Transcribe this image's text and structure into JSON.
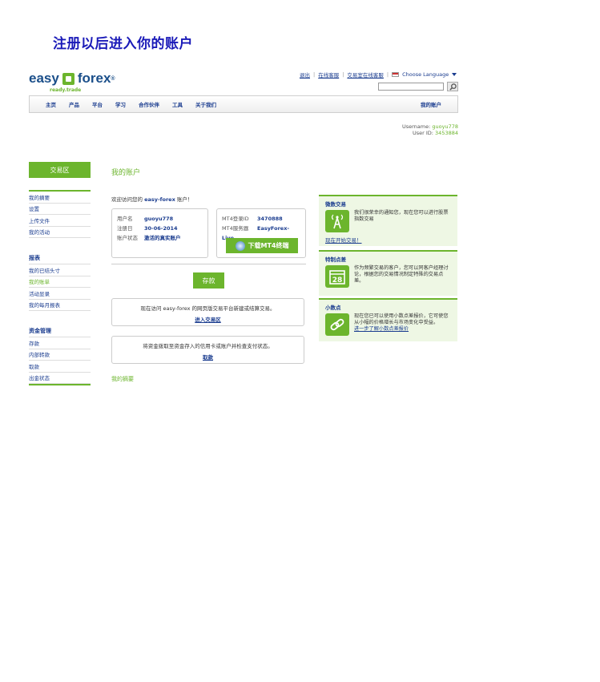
{
  "page_heading": "注册以后进入你的账户",
  "logo": {
    "word1": "easy",
    "word2": "forex",
    "reg": "®",
    "tagline": "ready.trade"
  },
  "top_links": {
    "logout": "退出",
    "support": "在线客服",
    "trading_room": "交易室在线客服",
    "language": "Choose Language"
  },
  "nav": {
    "items": [
      "主页",
      "产品",
      "平台",
      "学习",
      "合作伙伴",
      "工具",
      "关于我们"
    ],
    "my_account": "我的账户"
  },
  "user": {
    "username_label": "Username:",
    "username": "guoyu778",
    "userid_label": "User ID:",
    "userid": "3453884"
  },
  "sidebar": {
    "trade_button": "交易区",
    "group1": [
      "我的摘要",
      "设置",
      "上传文件",
      "我的活动"
    ],
    "group2_title": "报表",
    "group2": [
      "我的已结头寸",
      "我的账单",
      "活动显录",
      "我的每月报表"
    ],
    "group3_title": "资金管理",
    "group3": [
      "存款",
      "内部转款",
      "取款",
      "出金状态"
    ]
  },
  "main": {
    "title": "我的账户",
    "welcome_prefix": "欢迎访问您的 ",
    "welcome_brand": "easy-forex",
    "welcome_suffix": " 账户！",
    "account": {
      "username_label": "用户名",
      "username": "guoyu778",
      "reg_date_label": "注册日",
      "reg_date": "30-06-2014",
      "status_label": "账户状态",
      "status": "激活的真实账户"
    },
    "mt4": {
      "login_label": "MT4登录ID",
      "login": "3470888",
      "server_label": "MT4服务器",
      "server": "EasyForex-Live",
      "download_button": "下载MT4终端"
    },
    "deposit_button": "存款",
    "info1_text": "现在访问 easy-forex 的网页版交易平台新建或结算交易。",
    "info1_link": "进入交易区",
    "info2_text": "将资金拨取至资金存入的信用卡或账户并检查支付状态。",
    "info2_link": "取款",
    "summary_link": "我的摘要"
  },
  "promos": [
    {
      "title": "微数交易",
      "text": "我们很荣幸的通知您，现在您可以进行股票指数交易",
      "link": "现在开始交易！",
      "icon": "signal-tower-icon"
    },
    {
      "title": "特制点差",
      "text": "作为频繁交易的客户，您可以同客户经理讨论，根据您的交易情况制定特殊的交易点差。",
      "icon": "calendar-icon",
      "calendar_day": "28"
    },
    {
      "title": "小数点",
      "text": "现在您已可以使用小数点差报价，它可使您从小幅的价格增长与市场变化中受益。",
      "link": "进一步了解小数点差报价",
      "icon": "link-chain-icon"
    }
  ],
  "colors": {
    "brand_green": "#6cb52d",
    "brand_blue": "#1a3c8f",
    "heading_blue": "#1a1ab8"
  }
}
